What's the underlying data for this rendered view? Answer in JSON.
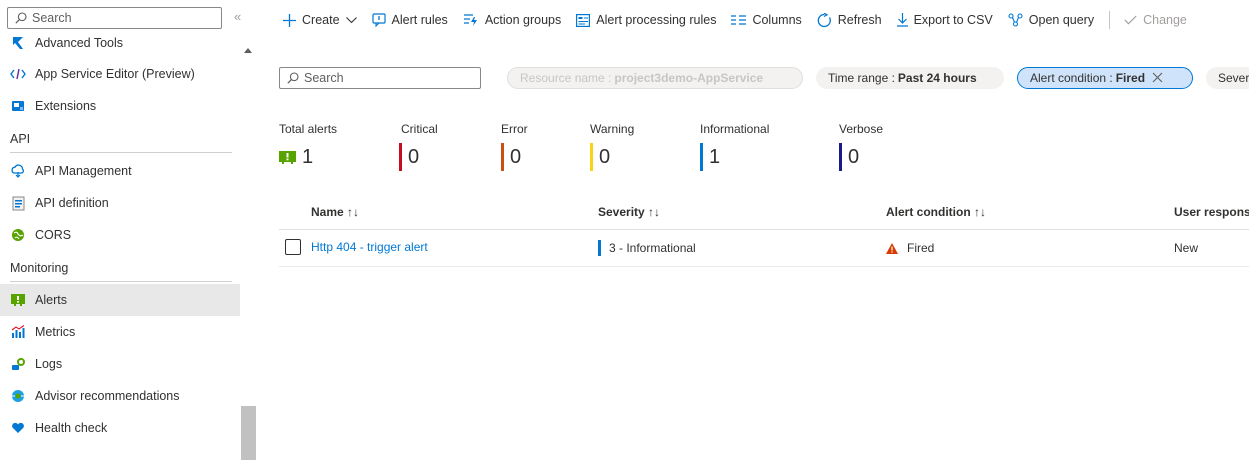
{
  "sidebar": {
    "search_placeholder": "Search",
    "collapse": "«",
    "items": [
      {
        "label": "Advanced Tools"
      },
      {
        "label": "App Service Editor (Preview)"
      },
      {
        "label": "Extensions"
      }
    ],
    "sections": [
      {
        "title": "API"
      },
      {
        "title": "Monitoring"
      }
    ],
    "api_items": [
      {
        "label": "API Management"
      },
      {
        "label": "API definition"
      },
      {
        "label": "CORS"
      }
    ],
    "monitoring_items": [
      {
        "label": "Alerts"
      },
      {
        "label": "Metrics"
      },
      {
        "label": "Logs"
      },
      {
        "label": "Advisor recommendations"
      },
      {
        "label": "Health check"
      }
    ]
  },
  "toolbar": {
    "create": "Create",
    "alert_rules": "Alert rules",
    "action_groups": "Action groups",
    "alert_processing_rules": "Alert processing rules",
    "columns": "Columns",
    "refresh": "Refresh",
    "export_csv": "Export to CSV",
    "open_query": "Open query",
    "change": "Change"
  },
  "filters": {
    "search_placeholder": "Search",
    "resource_name_label": "Resource name : ",
    "resource_name_value": "project3demo-AppService",
    "time_range_label": "Time range : ",
    "time_range_value": "Past 24 hours",
    "alert_condition_label": "Alert condition : ",
    "alert_condition_value": "Fired",
    "severity_label": "Severity"
  },
  "summary": {
    "total": {
      "label": "Total alerts",
      "value": "1"
    },
    "critical": {
      "label": "Critical",
      "value": "0",
      "color": "#c50f1f"
    },
    "error": {
      "label": "Error",
      "value": "0",
      "color": "#ca5010"
    },
    "warning": {
      "label": "Warning",
      "value": "0",
      "color": "#fcd116"
    },
    "informational": {
      "label": "Informational",
      "value": "1",
      "color": "#0078d4"
    },
    "verbose": {
      "label": "Verbose",
      "value": "0",
      "color": "#1b1a8a"
    }
  },
  "table": {
    "columns": [
      "Name ↑↓",
      "Severity ↑↓",
      "Alert condition ↑↓",
      "User response"
    ],
    "rows": [
      {
        "name": "Http 404 - trigger alert",
        "severity": "3 - Informational",
        "condition": "Fired",
        "user_response": "New"
      }
    ]
  },
  "colors": {
    "accent": "#0078d4",
    "fired_icon": "#d83b01",
    "alerts_icon": "#57a300"
  }
}
